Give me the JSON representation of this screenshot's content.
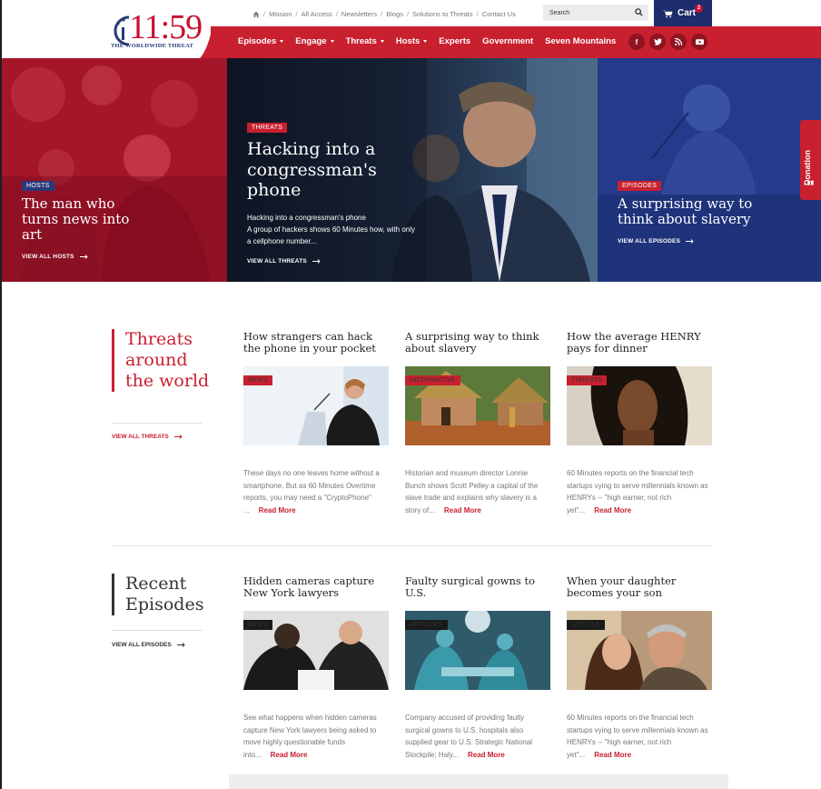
{
  "logo": {
    "number": "11:59",
    "tagline": "THE WORLDWIDE THREAT"
  },
  "topnav": {
    "items": [
      "Mission",
      "All Access",
      "Newsletters",
      "Blogs",
      "Solutions to Threats",
      "Contact Us"
    ]
  },
  "search": {
    "placeholder": "Search"
  },
  "cart": {
    "label": "Cart",
    "count": "2"
  },
  "mainnav": {
    "items": [
      {
        "label": "Episodes",
        "dropdown": true
      },
      {
        "label": "Engage",
        "dropdown": true
      },
      {
        "label": "Threats",
        "dropdown": true
      },
      {
        "label": "Hosts",
        "dropdown": true
      },
      {
        "label": "Experts",
        "dropdown": false
      },
      {
        "label": "Government",
        "dropdown": false
      },
      {
        "label": "Seven Mountains",
        "dropdown": false
      }
    ]
  },
  "social": [
    "facebook-icon",
    "twitter-icon",
    "rss-icon",
    "youtube-icon"
  ],
  "hero": {
    "left": {
      "tag": "HOSTS",
      "title": "The man who turns news into art",
      "link": "VIEW ALL HOSTS"
    },
    "mid": {
      "tag": "THREATS",
      "title": "Hacking into a congressman's phone",
      "summary_line1": "Hacking into a congressman's phone",
      "summary_line2": "A group of hackers shows 60 Minutes how, with only a cellphone number...",
      "link": "VIEW ALL THREATS"
    },
    "right": {
      "tag": "EPISODES",
      "title": "A surprising way to think about slavery",
      "link": "VIEW ALL EPISODES"
    }
  },
  "donation": {
    "label": "Donation"
  },
  "threats": {
    "title": "Threats around the world",
    "view_all": "VIEW ALL THREATS",
    "cards": [
      {
        "title": "How strangers can hack the phone in your pocket",
        "tag": "NEWS",
        "text": "These days no one leaves home without a smartphone. But as 60 Minutes Overtime reports, you may need a \"CryptoPhone\" ...",
        "more": "Read More"
      },
      {
        "title": "A surprising way to think about slavery",
        "tag": "INFORMATIVE",
        "text": "Historian and museum director Lonnie Bunch shows Scott Pelley a capital of the slave trade and explains why slavery is a story of...",
        "more": "Read More"
      },
      {
        "title": "How the average HENRY pays for dinner",
        "tag": "THREATS",
        "text": "60 Minutes reports on the financial tech startups vying to serve millennials known as HENRYs -- \"high earner, not rich yet\"...",
        "more": "Read More"
      }
    ]
  },
  "episodes": {
    "title": "Recent Episodes",
    "view_all": "VIEW ALL EPISODES",
    "cards": [
      {
        "title": "Hidden cameras capture New York lawyers",
        "tag": "NEWS",
        "text": "See what happens when hidden cameras capture New York lawyers being asked to move highly questionable funds into...",
        "more": "Read More"
      },
      {
        "title": "Faulty surgical gowns to U.S.",
        "tag": "ARTICLES",
        "text": "Company accused of providing faulty surgical gowns to U.S. hospitals also supplied gear to U.S. Strategic National Stockpile; Haly...",
        "more": "Read More"
      },
      {
        "title": "When your daughter becomes your son",
        "tag": "ARTICLE",
        "text": "60 Minutes reports on the financial tech startups vying to serve millennials known as HENRYs -- \"high earner, not rich yet\"...",
        "more": "Read More"
      }
    ]
  },
  "colors": {
    "brand_red": "#c8202f",
    "brand_navy": "#1f2c6b"
  }
}
